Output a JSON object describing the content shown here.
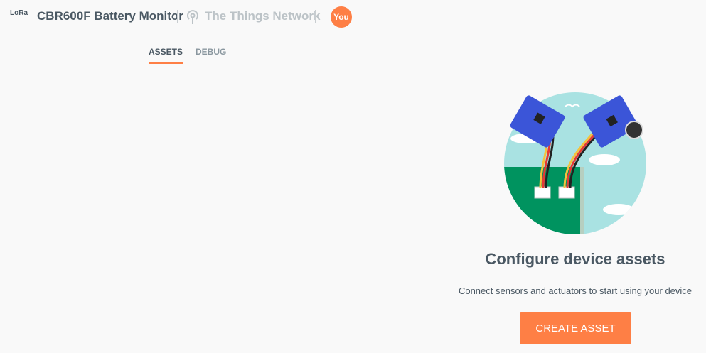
{
  "header": {
    "logo_text": "LoRa",
    "device_title": "CBR600F Battery Monitor",
    "network_name": "The Things Network",
    "network_icon": "antenna-icon",
    "avatar_label": "You"
  },
  "tabs": [
    {
      "label": "ASSETS",
      "active": true
    },
    {
      "label": "DEBUG",
      "active": false
    }
  ],
  "empty_state": {
    "heading": "Configure device assets",
    "description": "Connect sensors and actuators to start using your device",
    "button_label": "CREATE ASSET"
  },
  "colors": {
    "accent": "#fe7f45",
    "text": "#4a5863",
    "muted": "#bcc3c7"
  }
}
